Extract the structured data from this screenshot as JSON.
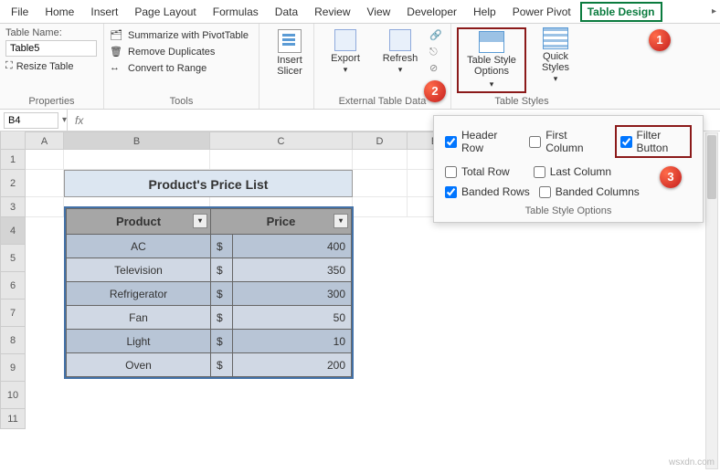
{
  "tabs": {
    "file": "File",
    "home": "Home",
    "insert": "Insert",
    "pageLayout": "Page Layout",
    "formulas": "Formulas",
    "data": "Data",
    "review": "Review",
    "view": "View",
    "developer": "Developer",
    "help": "Help",
    "powerPivot": "Power Pivot",
    "tableDesign": "Table Design"
  },
  "ribbon": {
    "props": {
      "tableNameLabel": "Table Name:",
      "tableName": "Table5",
      "resize": "Resize Table",
      "title": "Properties"
    },
    "tools": {
      "pivot": "Summarize with PivotTable",
      "dup": "Remove Duplicates",
      "range": "Convert to Range",
      "title": "Tools"
    },
    "slicer": {
      "label": "Insert\nSlicer"
    },
    "etd": {
      "export": "Export",
      "refresh": "Refresh",
      "title": "External Table Data"
    },
    "tso": {
      "label": "Table Style\nOptions",
      "qs": "Quick\nStyles",
      "title": "Table Styles"
    }
  },
  "nameBox": "B4",
  "fx": "fx",
  "cols": {
    "A": "A",
    "B": "B",
    "C": "C",
    "D": "D",
    "E": "E"
  },
  "rows": [
    "1",
    "2",
    "3",
    "4",
    "5",
    "6",
    "7",
    "8",
    "9",
    "10",
    "11"
  ],
  "sheet": {
    "title": "Product's Price List",
    "headers": {
      "product": "Product",
      "price": "Price"
    },
    "data": [
      {
        "name": "AC",
        "sym": "$",
        "val": "400"
      },
      {
        "name": "Television",
        "sym": "$",
        "val": "350"
      },
      {
        "name": "Refrigerator",
        "sym": "$",
        "val": "300"
      },
      {
        "name": "Fan",
        "sym": "$",
        "val": "50"
      },
      {
        "name": "Light",
        "sym": "$",
        "val": "10"
      },
      {
        "name": "Oven",
        "sym": "$",
        "val": "200"
      }
    ]
  },
  "popup": {
    "headerRow": "Header Row",
    "totalRow": "Total Row",
    "bandedRows": "Banded Rows",
    "firstCol": "First Column",
    "lastCol": "Last Column",
    "bandedCols": "Banded Columns",
    "filterBtn": "Filter Button",
    "title": "Table Style Options"
  },
  "markers": {
    "m1": "1",
    "m2": "2",
    "m3": "3"
  },
  "watermark": "wsxdn.com"
}
